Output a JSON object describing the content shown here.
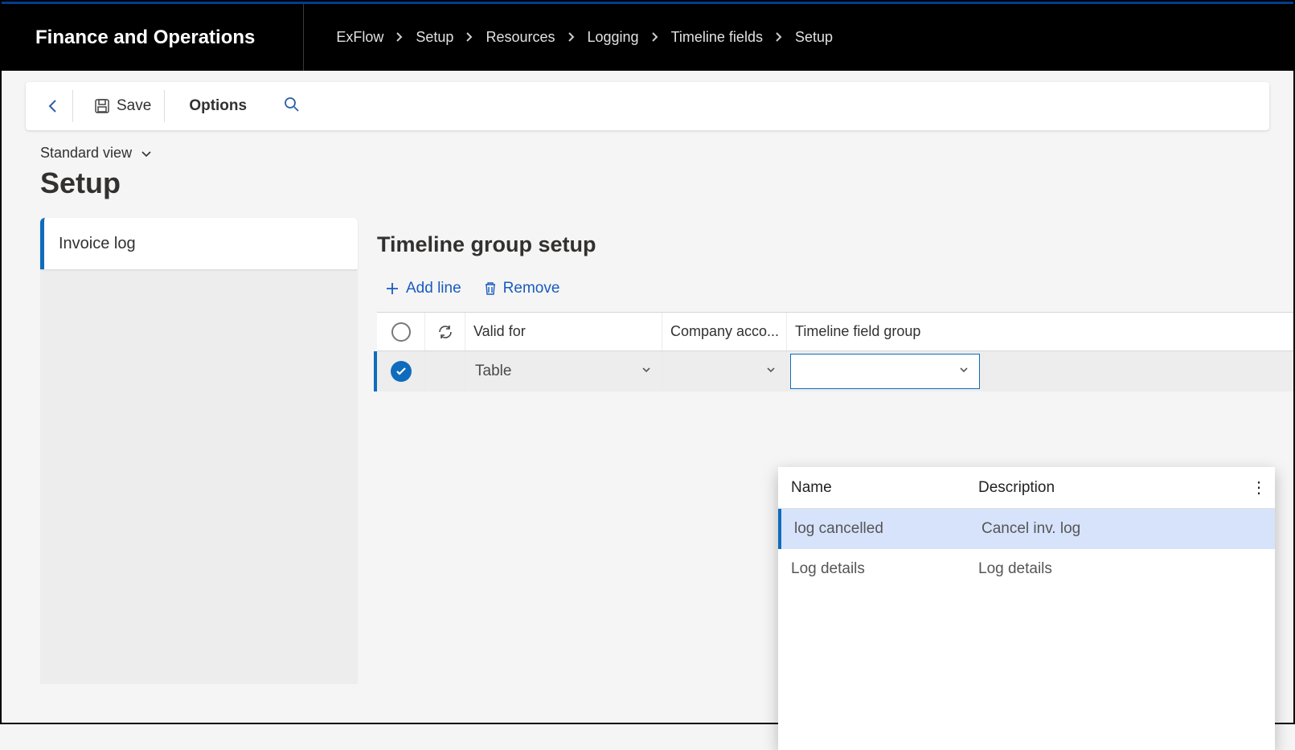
{
  "app_title": "Finance and Operations",
  "breadcrumb": [
    "ExFlow",
    "Setup",
    "Resources",
    "Logging",
    "Timeline fields",
    "Setup"
  ],
  "toolbar": {
    "save_label": "Save",
    "options_label": "Options"
  },
  "view_switcher": "Standard view",
  "page_title": "Setup",
  "side_tab": "Invoice log",
  "content_title": "Timeline group setup",
  "actions": {
    "add_line": "Add line",
    "remove": "Remove"
  },
  "columns": {
    "valid_for": "Valid for",
    "company": "Company acco...",
    "timeline_group": "Timeline field group"
  },
  "row": {
    "valid_for_value": "Table",
    "company_value": "",
    "timeline_value": ""
  },
  "lookup": {
    "col_name": "Name",
    "col_desc": "Description",
    "rows": [
      {
        "name": "log cancelled",
        "desc": "Cancel inv. log"
      },
      {
        "name": "Log details",
        "desc": "Log details"
      }
    ]
  }
}
